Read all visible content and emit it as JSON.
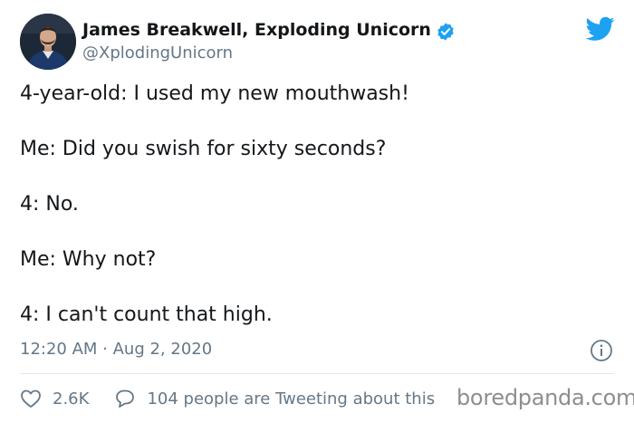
{
  "author": {
    "name": "James Breakwell, Exploding Unicorn",
    "handle": "@XplodingUnicorn",
    "verified": true
  },
  "tweet": {
    "lines": [
      "4-year-old: I used my new mouthwash!",
      "Me: Did you swish for sixty seconds?",
      "4: No.",
      "Me: Why not?",
      "4: I can't count that high."
    ],
    "timestamp": "12:20 AM · Aug 2, 2020"
  },
  "actions": {
    "likes": "2.6K",
    "discussion": "104 people are Tweeting about this"
  },
  "watermark": "boredpanda.com",
  "icons": {
    "verified": "verified-badge-icon",
    "brand": "twitter-bird-icon",
    "info": "info-icon",
    "like": "heart-icon",
    "reply": "speech-bubble-icon"
  },
  "colors": {
    "twitter_blue": "#1da1f2",
    "text_primary": "#14171a",
    "text_secondary": "#657786",
    "divider": "#e1e8ed",
    "watermark": "#8e8e8e"
  }
}
